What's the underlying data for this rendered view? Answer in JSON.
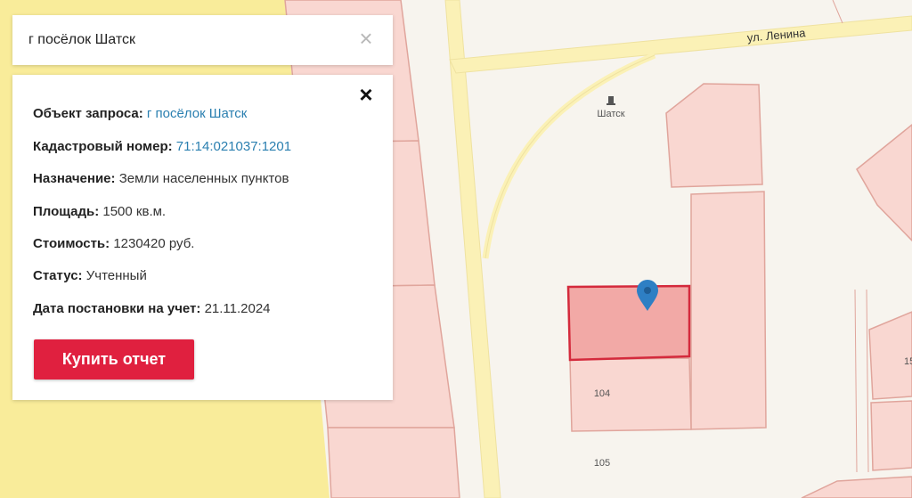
{
  "search": {
    "value": "г посёлок Шатск",
    "clear_symbol": "×"
  },
  "info": {
    "close_symbol": "×",
    "object_label": "Объект запроса:",
    "object_value": "г посёлок Шатск",
    "cadastral_label": "Кадастровый номер:",
    "cadastral_value": "71:14:021037:1201",
    "purpose_label": "Назначение:",
    "purpose_value": "Земли населенных пунктов",
    "area_label": "Площадь:",
    "area_value": "1500 кв.м.",
    "cost_label": "Стоимость:",
    "cost_value": "1230420 руб.",
    "status_label": "Статус:",
    "status_value": "Учтенный",
    "date_label": "Дата постановки на учет:",
    "date_value": "21.11.2024",
    "buy_label": "Купить отчет"
  },
  "map": {
    "street_label": "ул. Ленина",
    "place_label": "Шатск",
    "parcel_labels": [
      "104",
      "105",
      "15"
    ],
    "marker_icon": "location-pin-icon",
    "place_icon": "landmark-icon",
    "colors": {
      "parcel_fill": "#f9d7d1",
      "parcel_stroke": "#e0a59c",
      "selected_fill": "#f2a9a6",
      "selected_stroke": "#d42a3c",
      "road": "#fbf1b6",
      "road_border": "#efe2a0",
      "yellow_zone": "#f9ec9a",
      "marker": "#2e7fc4",
      "link": "#2a7fb0",
      "button": "#e0203f"
    }
  }
}
